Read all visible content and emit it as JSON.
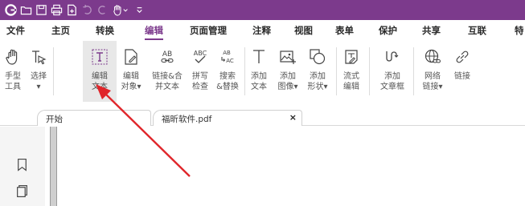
{
  "quick_access": {
    "icons": [
      "app-logo-icon",
      "open-folder-icon",
      "save-icon",
      "print-icon",
      "new-doc-icon",
      "undo-icon",
      "redo-icon",
      "hand-dropdown-icon",
      "customize-dropdown-icon"
    ]
  },
  "menu": {
    "tabs": [
      "文件",
      "主页",
      "转换",
      "编辑",
      "页面管理",
      "注释",
      "视图",
      "表单",
      "保护",
      "共享",
      "互联",
      "特"
    ],
    "active": "编辑",
    "active_color": "#7c3a8c"
  },
  "ribbon": {
    "tools": [
      {
        "line1": "手型",
        "line2": "工具",
        "icon": "hand-icon"
      },
      {
        "line1": "选择",
        "line2": "▾",
        "icon": "select-cursor-icon"
      },
      {
        "line1": "编辑",
        "line2": "文本",
        "icon": "edit-text-icon",
        "selected": true
      },
      {
        "line1": "编辑",
        "line2": "对象▾",
        "icon": "edit-object-icon"
      },
      {
        "line1": "链接&合",
        "line2": "并文本",
        "icon": "link-merge-text-icon"
      },
      {
        "line1": "拼写",
        "line2": "检查",
        "icon": "spell-check-icon"
      },
      {
        "line1": "搜索",
        "line2": "&替换",
        "icon": "search-replace-icon"
      },
      {
        "line1": "添加",
        "line2": "文本",
        "icon": "add-text-icon"
      },
      {
        "line1": "添加",
        "line2": "图像▾",
        "icon": "add-image-icon"
      },
      {
        "line1": "添加",
        "line2": "形状▾",
        "icon": "add-shape-icon"
      },
      {
        "line1": "流式",
        "line2": "编辑",
        "icon": "flow-edit-icon"
      },
      {
        "line1": "添加",
        "line2": "文章框",
        "icon": "article-box-icon"
      },
      {
        "line1": "网络",
        "line2": "链接▾",
        "icon": "web-link-icon"
      },
      {
        "line1": "链接",
        "line2": "",
        "icon": "link-icon"
      }
    ]
  },
  "doc_tabs": [
    {
      "label": "开始",
      "closable": false
    },
    {
      "label": "福昕软件.pdf",
      "closable": true,
      "close_glyph": "×"
    }
  ],
  "left_panel": {
    "icons": [
      "bookmark-icon",
      "pages-icon"
    ]
  },
  "colors": {
    "title_bar": "#7c3a8c",
    "annotation_arrow": "#e0262b"
  }
}
